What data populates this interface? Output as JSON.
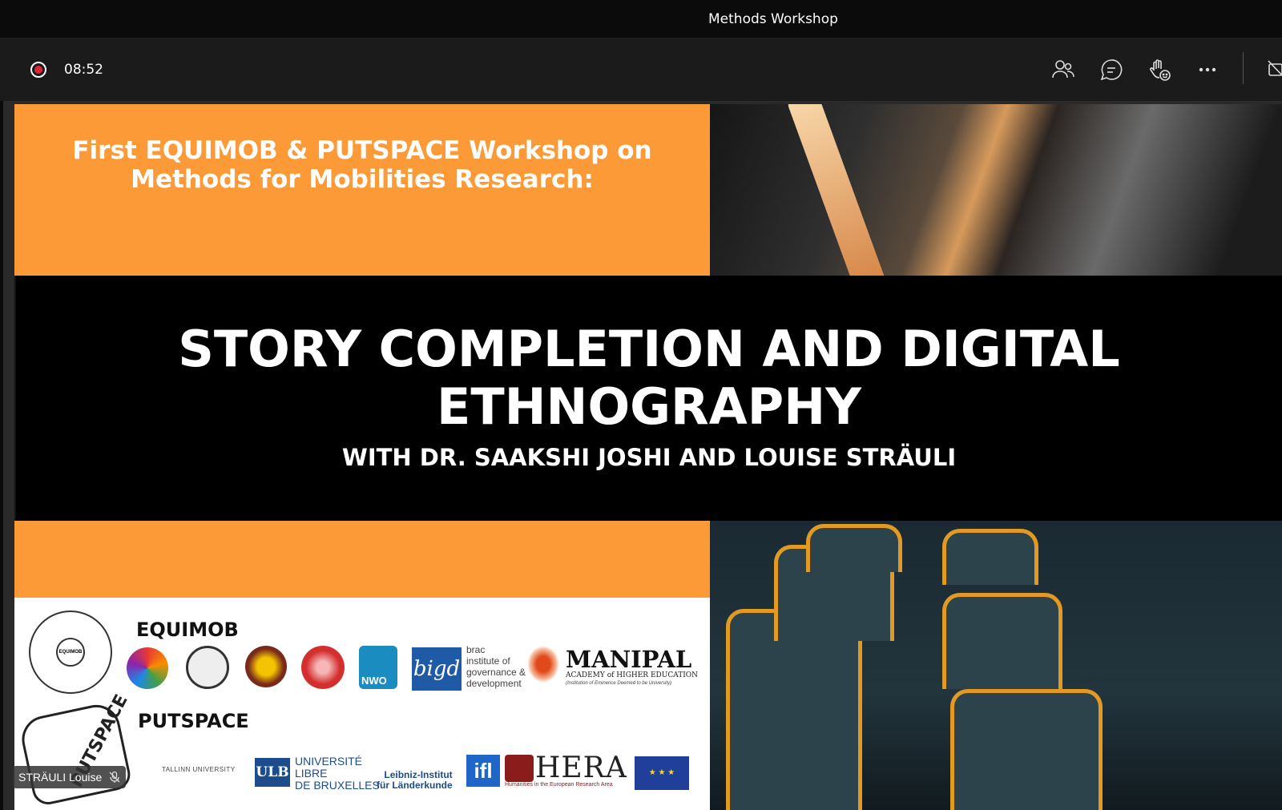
{
  "window": {
    "title": "Methods Workshop"
  },
  "toolbar": {
    "recording_time": "08:52",
    "icons": [
      "people-icon",
      "chat-icon",
      "raise-hand-icon",
      "more-options-icon",
      "camera-icon"
    ]
  },
  "slide": {
    "workshop_line1": "First EQUIMOB & PUTSPACE Workshop on",
    "workshop_line2": "Methods for Mobilities Research:",
    "title_line1": "STORY COMPLETION AND DIGITAL",
    "title_line2": "ETHNOGRAPHY",
    "subtitle": "WITH DR. SAAKSHI JOSHI AND LOUISE STRÄULI",
    "equimob_label": "EQUIMOB",
    "putspace_label": "PUTSPACE",
    "equimob_center": "EQUIMOB",
    "putspace_logo_text": "PUTSPACE",
    "nwo": "NWO",
    "bigd": "bigd",
    "brac_text": "brac\ninstitute of\ngovernance &\ndevelopment",
    "manipal_name": "MANIPAL",
    "manipal_sub": "ACADEMY of HIGHER EDUCATION",
    "manipal_sub2": "(Institution of Eminence Deemed to be University)",
    "tallinn": "TALLINN UNIVERSITY",
    "ulb": "ULB",
    "ulb_text": "UNIVERSITÉ\nLIBRE\nDE BRUXELLES",
    "leibniz": "Leibniz-Institut\nfür Länderkunde",
    "ifl": "ifl",
    "hera": "HERA",
    "hera_sub": "Humanities in the European Research Area",
    "colors": {
      "orange": "#fd9a38",
      "banner": "#000000",
      "rec_red": "#e0243c"
    }
  },
  "participant": {
    "name": "STRÄULI Louise"
  }
}
